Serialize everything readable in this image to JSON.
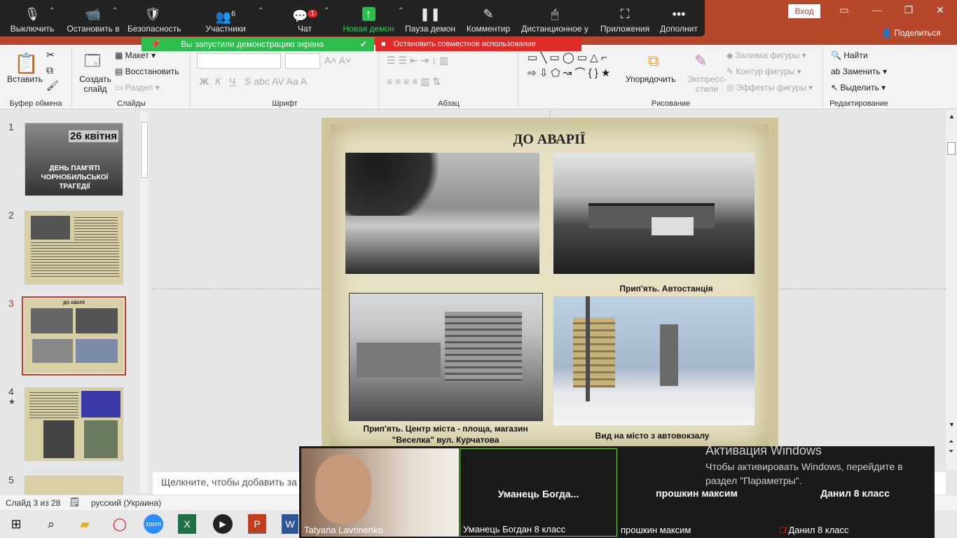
{
  "zoom_toolbar": {
    "mute": "Выключить",
    "video": "Остановить в",
    "security": "Безопасность",
    "participants": "Участники",
    "participants_count": "6",
    "chat": "Чат",
    "chat_badge": "1",
    "new_share": "Новая демон",
    "pause_share": "Пауза демон",
    "annotate": "Комментир",
    "remote": "Дистанционное у",
    "apps": "Приложения",
    "more": "Дополнит"
  },
  "share_banner": {
    "status": "Вы запустили демонстрацию экрана",
    "stop": "Остановить совместное использование"
  },
  "titlebar": {
    "signin": "Вход",
    "share": "Поделиться"
  },
  "ribbon": {
    "clipboard": {
      "paste": "Вставить",
      "label": "Буфер обмена"
    },
    "slides": {
      "new_slide": "Создать слайд",
      "layout": "Макет",
      "reset": "Восстановить",
      "section": "Раздел",
      "label": "Слайды"
    },
    "font": {
      "label": "Шрифт"
    },
    "paragraph": {
      "label": "Абзац"
    },
    "drawing": {
      "arrange": "Упорядочить",
      "quick_styles": "Экспресс-стили",
      "fill": "Заливка фигуры",
      "outline": "Контур фигуры",
      "effects": "Эффекты фигуры",
      "label": "Рисование"
    },
    "editing": {
      "find": "Найти",
      "replace": "Заменить",
      "select": "Выделить",
      "label": "Редактирование"
    }
  },
  "thumbnails": [
    {
      "num": "1",
      "title": "26 квітня",
      "subtitle": "ДЕНЬ ПАМ'ЯТІ ЧОРНОБИЛЬСЬКОЇ ТРАГЕДІЇ"
    },
    {
      "num": "2"
    },
    {
      "num": "3",
      "title": "ДО АВАРІЇ"
    },
    {
      "num": "4",
      "star": "★"
    },
    {
      "num": "5"
    }
  ],
  "slide": {
    "title": "ДО АВАРІЇ",
    "cap_bus": "Прип'ять. Автостанція",
    "cap_center": "Прип'ять. Центр міста - площа, магазин \"Веселка\" вул. Курчатова",
    "cap_view": "Вид на місто з автовокзалу"
  },
  "notes_placeholder": "Щелкните, чтобы добавить за",
  "status": {
    "slide": "Слайд 3 из 28",
    "lang": "русский (Украина)"
  },
  "gallery": [
    {
      "name": "",
      "label": "Tatyana Lavrinenko"
    },
    {
      "name": "Уманець Богда...",
      "label": "Уманець Богдан 8 класс"
    },
    {
      "name": "прошкин максим",
      "label": "прошкин максим"
    },
    {
      "name": "Данил 8 класс",
      "label": "Данил 8 класс"
    }
  ],
  "activation": {
    "title": "Активация Windows",
    "text": "Чтобы активировать Windows, перейдите в раздел \"Параметры\"."
  }
}
